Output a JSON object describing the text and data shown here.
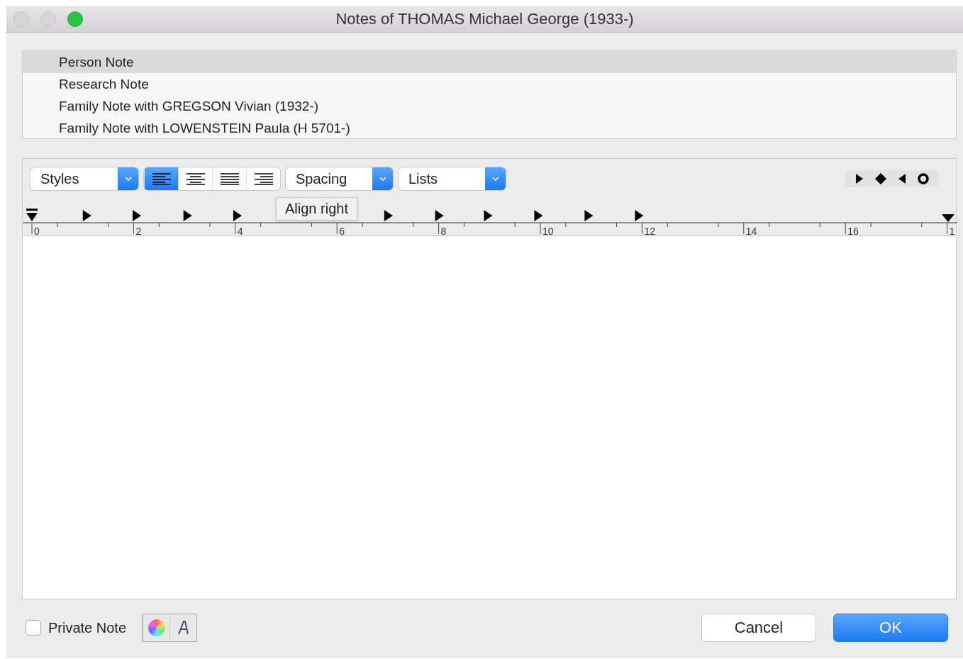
{
  "window": {
    "title": "Notes of THOMAS Michael George (1933-)"
  },
  "notes": [
    {
      "label": "Person Note",
      "selected": true
    },
    {
      "label": "Research Note",
      "selected": false
    },
    {
      "label": "Family Note with GREGSON Vivian (1932-)",
      "selected": false
    },
    {
      "label": "Family Note with LOWENSTEIN Paula (H 5701-)",
      "selected": false
    }
  ],
  "toolbar": {
    "styles": "Styles",
    "spacing": "Spacing",
    "lists": "Lists",
    "alignment": [
      {
        "kind": "left",
        "selected": true
      },
      {
        "kind": "center",
        "selected": false
      },
      {
        "kind": "justify",
        "selected": false
      },
      {
        "kind": "right",
        "selected": false
      }
    ],
    "tooltip": "Align right"
  },
  "ruler": {
    "labels": [
      "0",
      "2",
      "4",
      "6",
      "8",
      "10",
      "12",
      "14",
      "16",
      "1"
    ]
  },
  "private_note": {
    "label": "Private Note",
    "checked": false
  },
  "buttons": {
    "cancel": "Cancel",
    "ok": "OK"
  }
}
